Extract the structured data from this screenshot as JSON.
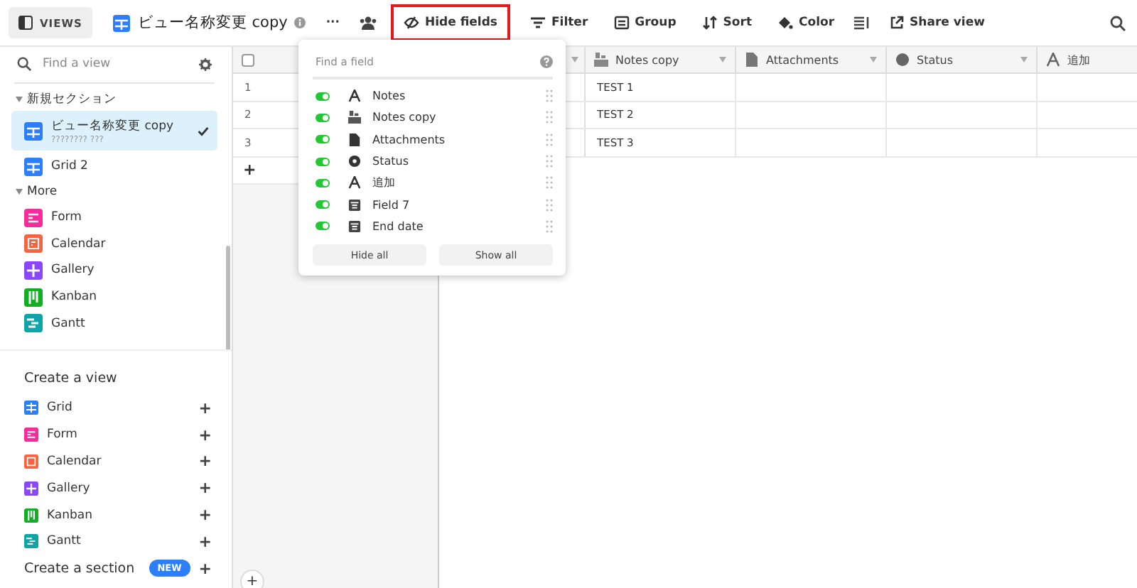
{
  "toolbar": {
    "views_label": "VIEWS",
    "view_title": "ビュー名称変更 copy",
    "more": "···",
    "buttons": [
      {
        "kind": "hide",
        "label": "Hide fields",
        "highlighted": true
      },
      {
        "kind": "filter",
        "label": "Filter",
        "highlighted": false
      },
      {
        "kind": "group",
        "label": "Group",
        "highlighted": false
      },
      {
        "kind": "sort",
        "label": "Sort",
        "highlighted": false
      },
      {
        "kind": "color",
        "label": "Color",
        "highlighted": false
      }
    ],
    "share_label": "Share view"
  },
  "sidebar": {
    "search_placeholder": "Find a view",
    "sections": [
      {
        "title": "新規セクション",
        "items": [
          {
            "kind": "grid",
            "color": "#2d7ff9",
            "label": "ビュー名称変更 copy",
            "sub": "???????? ???",
            "selected": true
          },
          {
            "kind": "grid",
            "color": "#2d7ff9",
            "label": "Grid 2",
            "selected": false
          }
        ]
      },
      {
        "title": "More",
        "items": [
          {
            "kind": "form",
            "color": "#f82b9c",
            "label": "Form",
            "selected": false
          },
          {
            "kind": "calendar",
            "color": "#f8643f",
            "label": "Calendar",
            "selected": false
          },
          {
            "kind": "gallery",
            "color": "#8b46ff",
            "label": "Gallery",
            "selected": false
          },
          {
            "kind": "kanban",
            "color": "#11af22",
            "label": "Kanban",
            "selected": false
          },
          {
            "kind": "gantt",
            "color": "#0fa5a8",
            "label": "Gantt",
            "selected": false
          }
        ]
      }
    ],
    "create_title": "Create a view",
    "create_items": [
      {
        "kind": "grid",
        "color": "#2d7ff9",
        "label": "Grid",
        "plus": "+"
      },
      {
        "kind": "form",
        "color": "#f82b9c",
        "label": "Form",
        "plus": "+"
      },
      {
        "kind": "calendar",
        "color": "#f8643f",
        "label": "Calendar",
        "plus": "+"
      },
      {
        "kind": "gallery",
        "color": "#8b46ff",
        "label": "Gallery",
        "plus": "+"
      },
      {
        "kind": "kanban",
        "color": "#11af22",
        "label": "Kanban",
        "plus": "+"
      },
      {
        "kind": "gantt",
        "color": "#0fa5a8",
        "label": "Gantt",
        "plus": "+"
      }
    ],
    "create_section": "Create a section",
    "new_badge": "NEW",
    "section_plus": "+"
  },
  "table": {
    "select_all_checked": false,
    "columns": [
      {
        "kind": "lookup",
        "label": "Notes copy"
      },
      {
        "kind": "attachment",
        "label": "Attachments"
      },
      {
        "kind": "status",
        "label": "Status"
      },
      {
        "kind": "text",
        "label": "追加"
      }
    ],
    "rows": [
      {
        "number": "1",
        "cells": [
          "TEST 1",
          "",
          "",
          ""
        ]
      },
      {
        "number": "2",
        "cells": [
          "TEST 2",
          "",
          "",
          ""
        ]
      },
      {
        "number": "3",
        "cells": [
          "TEST 3",
          "",
          "",
          ""
        ]
      }
    ],
    "add_row": "+",
    "add_bottom": "+"
  },
  "popover": {
    "placeholder": "Find a field",
    "fields": [
      {
        "kind": "text",
        "label": "Notes",
        "on": true
      },
      {
        "kind": "lookup",
        "label": "Notes copy",
        "on": true
      },
      {
        "kind": "attachment",
        "label": "Attachments",
        "on": true
      },
      {
        "kind": "status",
        "label": "Status",
        "on": true
      },
      {
        "kind": "text",
        "label": "追加",
        "on": true
      },
      {
        "kind": "date",
        "label": "Field 7",
        "on": true
      },
      {
        "kind": "date",
        "label": "End date",
        "on": true
      }
    ],
    "hide_all": "Hide all",
    "show_all": "Show all"
  }
}
